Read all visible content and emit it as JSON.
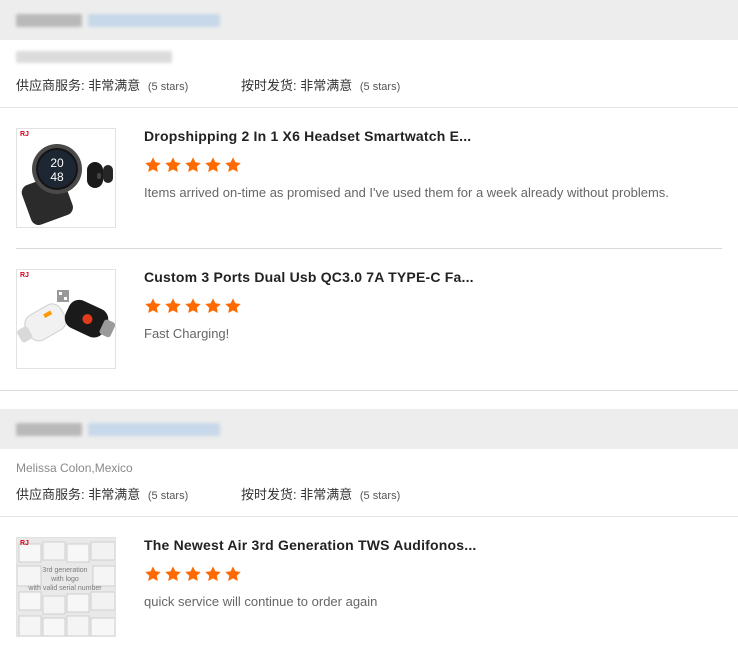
{
  "orders": [
    {
      "buyer_name": "",
      "ratings": [
        {
          "label": "供应商服务:",
          "value": "非常满意",
          "stars_text": "(5 stars)"
        },
        {
          "label": "按时发货:",
          "value": "非常满意",
          "stars_text": "(5 stars)"
        }
      ],
      "reviews": [
        {
          "thumb_badge": "RJ",
          "title": "Dropshipping 2 In 1 X6 Headset Smartwatch E...",
          "stars": 5,
          "text": "Items arrived on-time as promised and I've used them for a week already without problems.",
          "watch_time_top": "20",
          "watch_time_bottom": "48"
        },
        {
          "thumb_badge": "RJ",
          "title": "Custom 3 Ports Dual Usb QC3.0 7A TYPE-C Fa...",
          "stars": 5,
          "text": "Fast Charging!"
        }
      ]
    },
    {
      "buyer_name": "Melissa Colon,Mexico",
      "ratings": [
        {
          "label": "供应商服务:",
          "value": "非常满意",
          "stars_text": "(5 stars)"
        },
        {
          "label": "按时发货:",
          "value": "非常满意",
          "stars_text": "(5 stars)"
        }
      ],
      "reviews": [
        {
          "thumb_badge": "RJ",
          "title": "The Newest Air 3rd Generation TWS Audifonos...",
          "stars": 5,
          "text": "quick service will continue to order again",
          "thumb_caption_1": "3rd generation",
          "thumb_caption_2": "with logo",
          "thumb_caption_3": "with valid serial number"
        }
      ]
    }
  ],
  "colors": {
    "star": "#ff6a00",
    "header_bg": "#ededed",
    "divider": "#d9d9d9"
  },
  "icons": {
    "star": "star-icon"
  }
}
